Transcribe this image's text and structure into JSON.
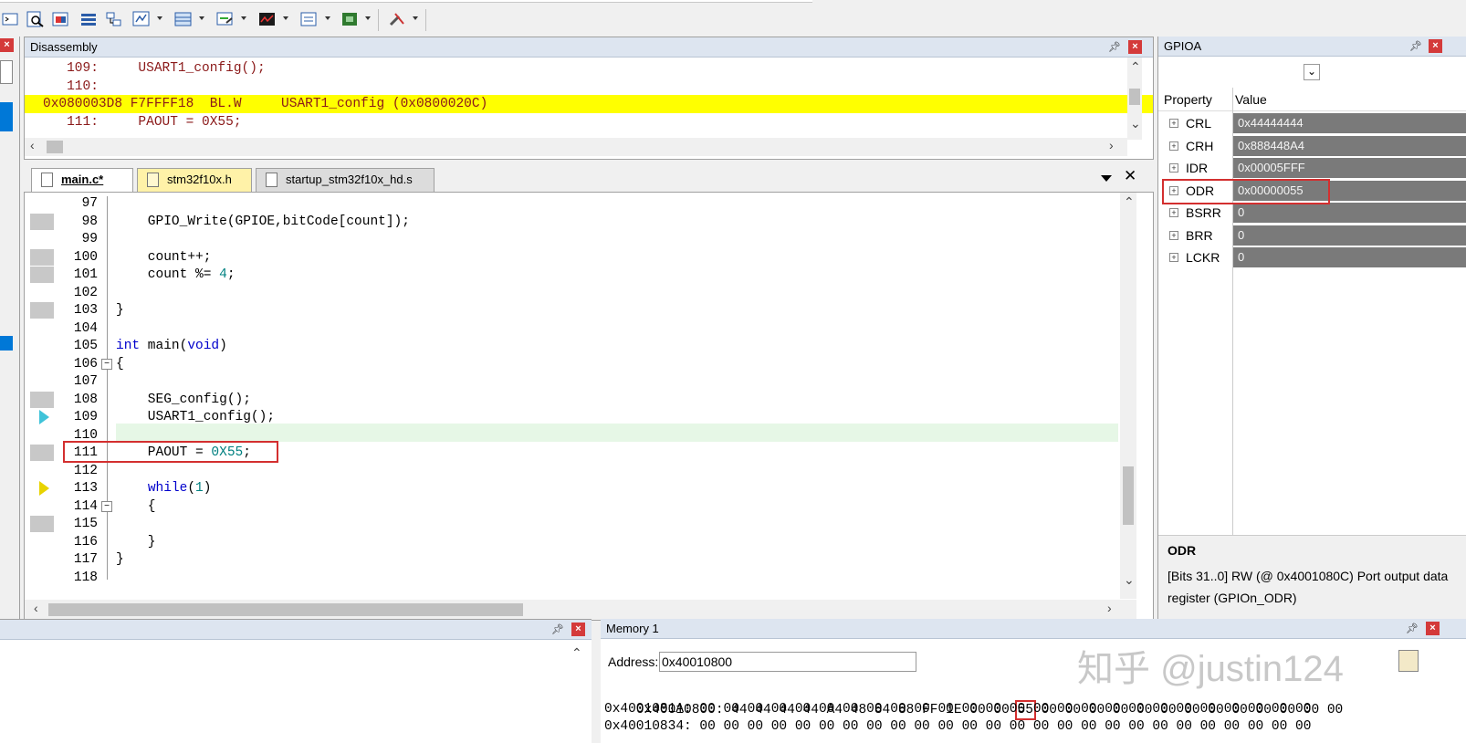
{
  "toolbar": {
    "buttons": [
      "command-window",
      "disassembly-window",
      "symbols-window",
      "registers-window",
      "call-stack-window",
      "watch-windows",
      "memory-windows",
      "serial-windows",
      "analysis-windows",
      "trace-windows",
      "system-viewer",
      "toolbox"
    ]
  },
  "disassembly": {
    "title": "Disassembly",
    "lines": [
      {
        "text": "   109:     USART1_config();",
        "type": "src"
      },
      {
        "text": "   110:",
        "type": "src"
      },
      {
        "text": "0x080003D8 F7FFFF18  BL.W     USART1_config (0x0800020C)",
        "type": "highlight"
      },
      {
        "text": "   111:     PAOUT = 0X55;",
        "type": "src"
      }
    ]
  },
  "tabs": [
    {
      "label": "main.c*",
      "active": true
    },
    {
      "label": "stm32f10x.h",
      "active": false
    },
    {
      "label": "startup_stm32f10x_hd.s",
      "active": false
    }
  ],
  "editor": {
    "lines": [
      {
        "n": "97",
        "code": ""
      },
      {
        "n": "98",
        "code": "    GPIO_Write(GPIOE,bitCode[count]);"
      },
      {
        "n": "99",
        "code": ""
      },
      {
        "n": "100",
        "code": "    count++;"
      },
      {
        "n": "101",
        "code": "    count %= 4;"
      },
      {
        "n": "102",
        "code": ""
      },
      {
        "n": "103",
        "code": "}"
      },
      {
        "n": "104",
        "code": ""
      },
      {
        "n": "105",
        "code": "int main(void)"
      },
      {
        "n": "106",
        "code": "{"
      },
      {
        "n": "107",
        "code": ""
      },
      {
        "n": "108",
        "code": "    SEG_config();"
      },
      {
        "n": "109",
        "code": "    USART1_config();"
      },
      {
        "n": "110",
        "code": ""
      },
      {
        "n": "111",
        "code": "    PAOUT = 0X55;"
      },
      {
        "n": "112",
        "code": ""
      },
      {
        "n": "113",
        "code": "    while(1)"
      },
      {
        "n": "114",
        "code": "    {"
      },
      {
        "n": "115",
        "code": ""
      },
      {
        "n": "116",
        "code": "    }"
      },
      {
        "n": "117",
        "code": "}"
      },
      {
        "n": "118",
        "code": ""
      }
    ]
  },
  "gpio": {
    "title": "GPIOA",
    "col_property": "Property",
    "col_value": "Value",
    "registers": [
      {
        "name": "CRL",
        "value": "0x44444444"
      },
      {
        "name": "CRH",
        "value": "0x888448A4"
      },
      {
        "name": "IDR",
        "value": "0x00005FFF"
      },
      {
        "name": "ODR",
        "value": "0x00000055"
      },
      {
        "name": "BSRR",
        "value": "0"
      },
      {
        "name": "BRR",
        "value": "0"
      },
      {
        "name": "LCKR",
        "value": "0"
      }
    ],
    "desc_title": "ODR",
    "desc_text": "[Bits 31..0] RW (@ 0x4001080C) Port output data register  (GPIOn_ODR)"
  },
  "memory": {
    "title": "Memory 1",
    "address_label": "Address:",
    "address_value": "0x40010800",
    "row1_addr": "0x40010800:",
    "row1_pre": "44 44 44 44 A4 48 84 88 FF 1E 00 00",
    "row1_hl": "55",
    "row1_post": "00 00 00 00 00 00 00 00 00 00 00 00 00",
    "row2": "0x4001081A: 00 00 00 00 00 00 00 00 00 00 00 00 00 00 00 00 00 00 00 00 00 00 00 00 00 00",
    "row3": "0x40010834: 00 00 00 00 00 00 00 00 00 00 00 00 00 00 00 00 00 00 00 00 00 00 00 00 00 00"
  },
  "watermark": "知乎 @justin124"
}
